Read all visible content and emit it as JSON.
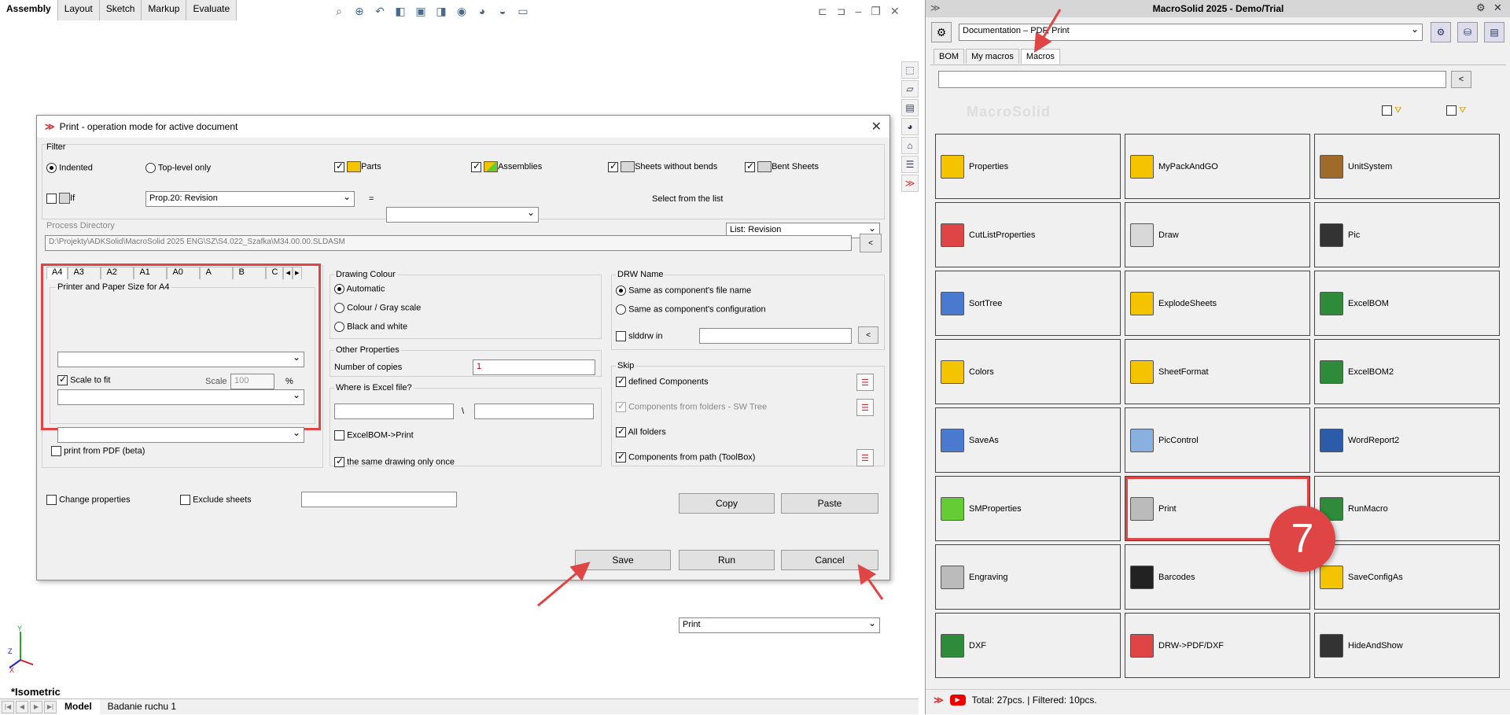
{
  "cad": {
    "tabs": [
      "Assembly",
      "Layout",
      "Sketch",
      "Markup",
      "Evaluate"
    ],
    "view_label": "*Isometric",
    "bottom_tabs": [
      "Model",
      "Badanie ruchu 1"
    ],
    "hud_icons": [
      "zoom-fit-icon",
      "zoom-area-icon",
      "previous-view-icon",
      "section-view-icon",
      "view-orientation-icon",
      "display-style-icon",
      "hide-show-icon",
      "appearance-icon",
      "scene-icon",
      "view-settings-icon"
    ]
  },
  "dialog": {
    "title": "Print - operation mode for active document",
    "filter": {
      "group_label": "Filter",
      "indented": "Indented",
      "top_level": "Top-level only",
      "parts": "Parts",
      "assemblies": "Assemblies",
      "sheets_without_bends": "Sheets without bends",
      "bent_sheets": "Bent Sheets",
      "if_label": "If",
      "prop_value": "Prop.20: Revision",
      "equals": "=",
      "select_from_list_label": "Select from the list",
      "list_value": "List: Revision"
    },
    "process_dir": {
      "label": "Process Directory",
      "value": "D:\\Projekty\\ADKSolid\\MacroSolid 2025 ENG\\SZ\\S4.022_Szafka\\M34.00.00.SLDASM",
      "back": "<"
    },
    "paper": {
      "tabs": [
        "A4",
        "A3",
        "A2",
        "A1",
        "A0",
        "A",
        "B",
        "C"
      ],
      "group_label": "Printer and Paper Size for A4",
      "scale_to_fit": "Scale to fit",
      "scale_label": "Scale",
      "scale_value": "100",
      "percent": "%",
      "print_pdf": "print from PDF (beta)"
    },
    "drawing_colour": {
      "label": "Drawing Colour",
      "options": [
        "Automatic",
        "Colour / Gray scale",
        "Black and white"
      ]
    },
    "other_props": {
      "label": "Other Properties",
      "copies_label": "Number of copies",
      "copies_value": "1"
    },
    "excel": {
      "label": "Where is Excel file?",
      "sep": "\\",
      "excelbom_print": "ExcelBOM->Print",
      "same_drawing_once": "the same drawing only once"
    },
    "drw_name": {
      "label": "DRW Name",
      "opt1": "Same as component's file name",
      "opt2": "Same as component's configuration",
      "slddrw_in": "slddrw in",
      "back": "<"
    },
    "skip": {
      "label": "Skip",
      "defined": "defined Components",
      "from_folders": "Components from folders - SW Tree",
      "all_folders": "All folders",
      "from_path": "Components from path (ToolBox)"
    },
    "bottom": {
      "change_props": "Change properties",
      "exclude_sheets": "Exclude sheets",
      "copy": "Copy",
      "paste": "Paste",
      "mode_value": "Print",
      "save": "Save",
      "run": "Run",
      "cancel": "Cancel"
    }
  },
  "panel": {
    "title": "MacroSolid 2025 - Demo/Trial",
    "combo_value": "Documentation – PDF, Print",
    "tabs": [
      "BOM",
      "My macros",
      "Macros"
    ],
    "watermark": "MacroSolid",
    "back": "<",
    "tiles": [
      {
        "label": "Properties",
        "icon": "properties-icon",
        "color": "#f5c400"
      },
      {
        "label": "MyPackAndGO",
        "icon": "pack-and-go-icon",
        "color": "#f5c400"
      },
      {
        "label": "UnitSystem",
        "icon": "unit-system-icon",
        "color": "#a06a2a"
      },
      {
        "label": "CutListProperties",
        "icon": "cutlist-icon",
        "color": "#e04545"
      },
      {
        "label": "Draw",
        "icon": "draw-icon",
        "color": "#d8d8d8"
      },
      {
        "label": "Pic",
        "icon": "camera-icon",
        "color": "#333333"
      },
      {
        "label": "SortTree",
        "icon": "sort-tree-icon",
        "color": "#4a7ad0"
      },
      {
        "label": "ExplodeSheets",
        "icon": "explode-sheets-icon",
        "color": "#f5c400"
      },
      {
        "label": "ExcelBOM",
        "icon": "excel-icon",
        "color": "#2e8b3a"
      },
      {
        "label": "Colors",
        "icon": "ral-colors-icon",
        "color": "#f5c400"
      },
      {
        "label": "SheetFormat",
        "icon": "sheet-format-icon",
        "color": "#f5c400"
      },
      {
        "label": "ExcelBOM2",
        "icon": "excel2-icon",
        "color": "#2e8b3a"
      },
      {
        "label": "SaveAs",
        "icon": "save-as-icon",
        "color": "#4a7ad0"
      },
      {
        "label": "PicControl",
        "icon": "pic-control-icon",
        "color": "#8ab0e0"
      },
      {
        "label": "WordReport2",
        "icon": "word-icon",
        "color": "#2b5caa"
      },
      {
        "label": "SMProperties",
        "icon": "sm-properties-icon",
        "color": "#6c3"
      },
      {
        "label": "Print",
        "icon": "printer-icon",
        "color": "#bbbbbb"
      },
      {
        "label": "RunMacro",
        "icon": "run-macro-icon",
        "color": "#2e8b3a"
      },
      {
        "label": "Engraving",
        "icon": "engraving-icon",
        "color": "#bbbbbb"
      },
      {
        "label": "Barcodes",
        "icon": "qr-code-icon",
        "color": "#222222"
      },
      {
        "label": "SaveConfigAs",
        "icon": "save-config-icon",
        "color": "#f5c400"
      },
      {
        "label": "DXF",
        "icon": "dxf-icon",
        "color": "#2e8b3a"
      },
      {
        "label": "DRW->PDF/DXF",
        "icon": "pdf-icon",
        "color": "#e04545"
      },
      {
        "label": "HideAndShow",
        "icon": "eye-icon",
        "color": "#333333"
      }
    ],
    "status": "Total: 27pcs. | Filtered: 10pcs."
  },
  "annotation": {
    "badge": "7",
    "accent": "#e04545"
  }
}
